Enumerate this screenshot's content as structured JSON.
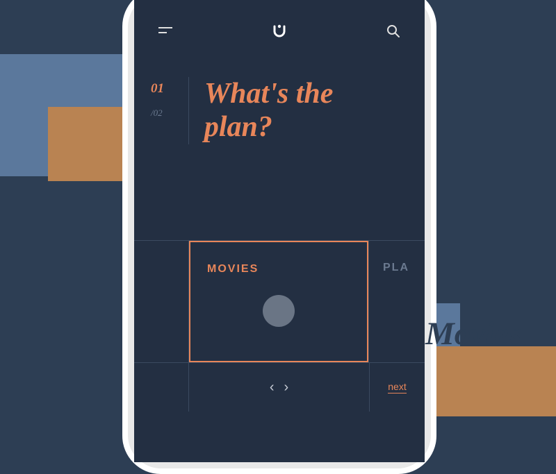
{
  "background": {
    "label": "Movies"
  },
  "step": {
    "current": "01",
    "total": "/02"
  },
  "heading": "What's the plan?",
  "cards": {
    "selected": {
      "label": "MOVIES"
    },
    "next": {
      "label": "PLA"
    }
  },
  "footer": {
    "prev_glyph": "‹",
    "next_glyph": "›",
    "next_label": "next"
  },
  "colors": {
    "accent": "#e8865a",
    "navy": "#2d3e54",
    "screen": "#232f42",
    "blue_block": "#5b789c",
    "brown_block": "#b98352"
  }
}
